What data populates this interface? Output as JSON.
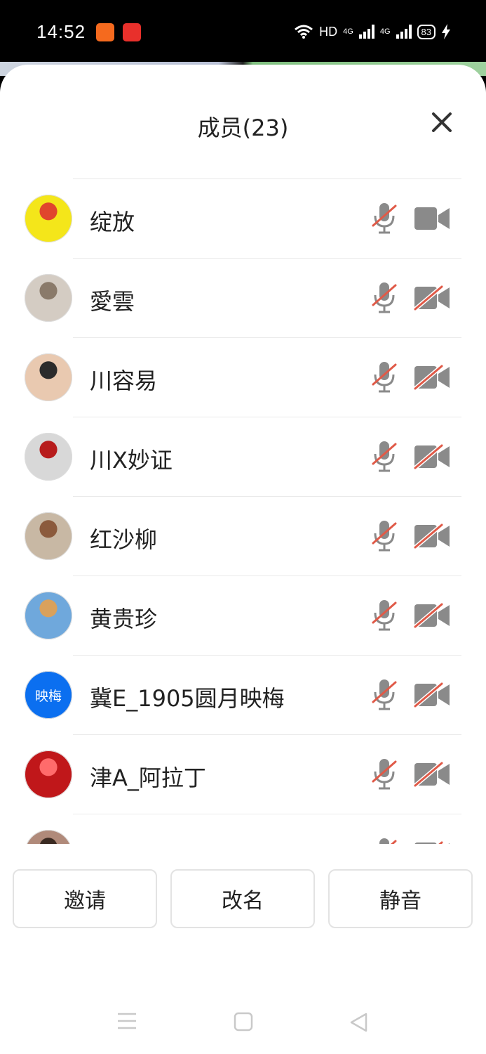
{
  "status_bar": {
    "time": "14:52",
    "network_label": "HD",
    "signal1_label": "4G",
    "signal2_label": "4G",
    "battery": "83"
  },
  "sheet": {
    "title": "成员(23)",
    "close_icon": "close-icon"
  },
  "members": [
    {
      "name": "绽放",
      "avatar_bg": "#f4e61a",
      "avatar_fg": "#e0462d",
      "mic": "muted",
      "camera": "on"
    },
    {
      "name": "愛雲",
      "avatar_bg": "#d4ccc3",
      "avatar_fg": "#8a7a6a",
      "mic": "muted",
      "camera": "off"
    },
    {
      "name": "川容易",
      "avatar_bg": "#e9c9b0",
      "avatar_fg": "#2b2b2b",
      "mic": "muted",
      "camera": "off"
    },
    {
      "name": "川X妙证",
      "avatar_bg": "#d8d8d8",
      "avatar_fg": "#b71c1c",
      "mic": "muted",
      "camera": "off"
    },
    {
      "name": "红沙柳",
      "avatar_bg": "#c8b8a4",
      "avatar_fg": "#8b5a3c",
      "mic": "muted",
      "camera": "off"
    },
    {
      "name": "黄贵珍",
      "avatar_bg": "#6fa8dc",
      "avatar_fg": "#d9a15c",
      "mic": "muted",
      "camera": "off"
    },
    {
      "name": "冀E_1905圆月映梅",
      "avatar_bg": "#0b6ff0",
      "avatar_fg": "#ffffff",
      "avatar_text": "映梅",
      "mic": "muted",
      "camera": "off"
    },
    {
      "name": "津A_阿拉丁",
      "avatar_bg": "#c0171a",
      "avatar_fg": "#ff6b6b",
      "mic": "muted",
      "camera": "off"
    },
    {
      "name": "",
      "avatar_bg": "#b08a7a",
      "avatar_fg": "#3a2a22",
      "mic": "muted",
      "camera": "off"
    }
  ],
  "actions": {
    "invite": "邀请",
    "rename": "改名",
    "mute": "静音"
  },
  "colors": {
    "muted_slash": "#e05a48",
    "icon_gray": "#8a8a8a"
  },
  "nav": {
    "menu_icon": "menu-icon",
    "home_icon": "home-icon",
    "back_icon": "back-icon"
  }
}
